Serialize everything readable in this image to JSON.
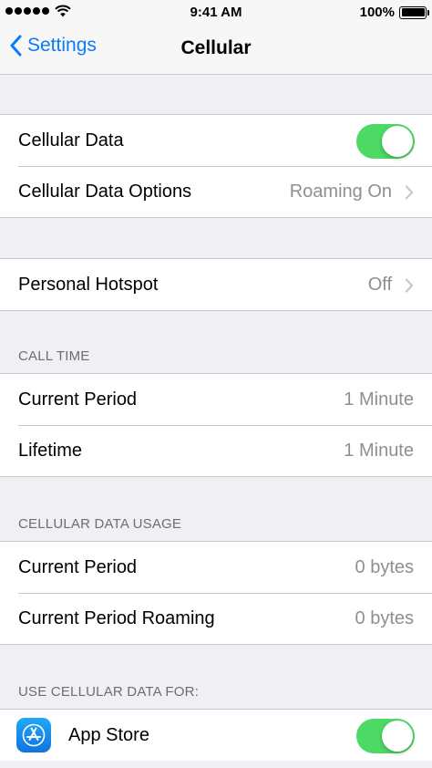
{
  "status_bar": {
    "time": "9:41 AM",
    "battery": "100%",
    "signal_icon": "signal-dots-icon",
    "wifi_icon": "wifi-icon",
    "battery_icon": "battery-icon"
  },
  "nav": {
    "back_label": "Settings",
    "title": "Cellular",
    "accent_color": "#0a7aff"
  },
  "group1": {
    "cellular_data": {
      "label": "Cellular Data",
      "toggle": true
    },
    "cellular_data_options": {
      "label": "Cellular Data Options",
      "value": "Roaming On"
    }
  },
  "group2": {
    "personal_hotspot": {
      "label": "Personal Hotspot",
      "value": "Off"
    }
  },
  "call_time": {
    "header": "CALL TIME",
    "rows": [
      {
        "label": "Current Period",
        "value": "1 Minute"
      },
      {
        "label": "Lifetime",
        "value": "1 Minute"
      }
    ]
  },
  "data_usage": {
    "header": "CELLULAR DATA USAGE",
    "rows": [
      {
        "label": "Current Period",
        "value": "0 bytes"
      },
      {
        "label": "Current Period Roaming",
        "value": "0 bytes"
      }
    ]
  },
  "use_data_for": {
    "header": "USE CELLULAR DATA FOR:",
    "apps": [
      {
        "label": "App Store",
        "icon": "app-store-icon",
        "toggle": true
      }
    ]
  },
  "colors": {
    "toggle_on": "#4cd964",
    "background": "#efeff4",
    "secondary_text": "#8e8e93"
  }
}
